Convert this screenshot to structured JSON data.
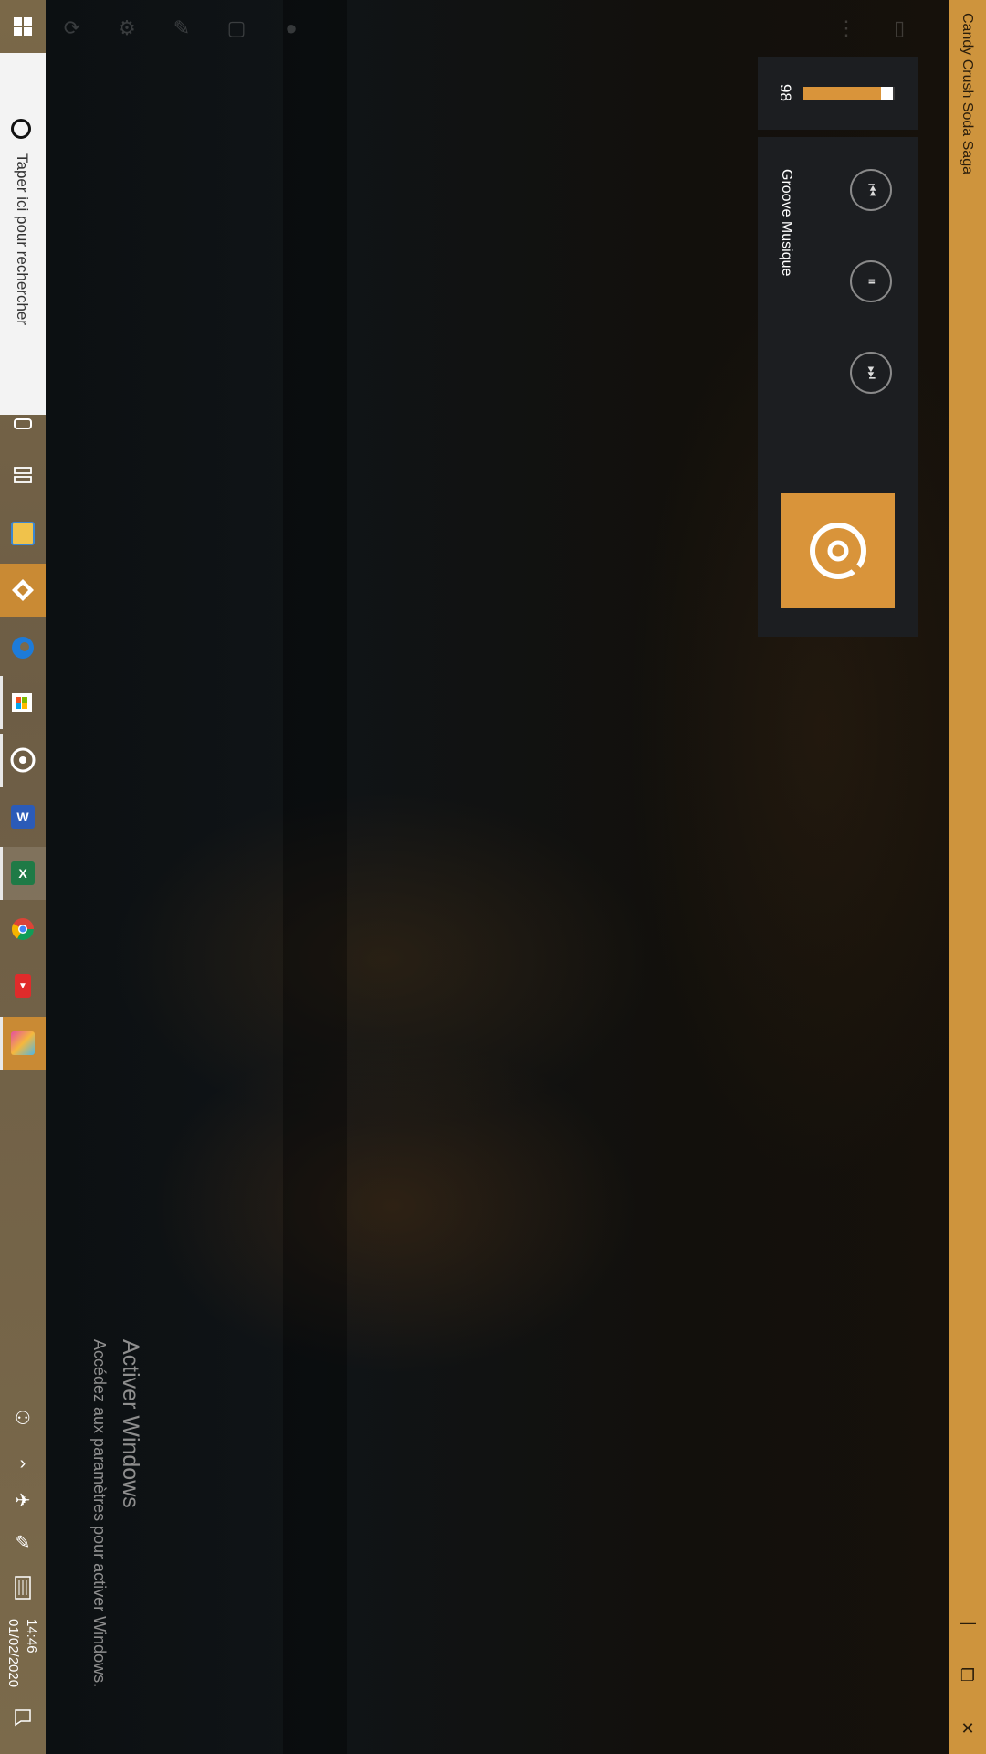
{
  "taskbar": {
    "search_placeholder": "Taper ici pour rechercher",
    "apps": [
      {
        "name": "file-explorer"
      },
      {
        "name": "brave-browser"
      },
      {
        "name": "edge"
      },
      {
        "name": "microsoft-store"
      },
      {
        "name": "groove-music"
      },
      {
        "name": "word"
      },
      {
        "name": "excel"
      },
      {
        "name": "chrome"
      },
      {
        "name": "youtube"
      },
      {
        "name": "candy-crush"
      }
    ],
    "clock": {
      "time": "14:46",
      "date": "01/02/2020"
    }
  },
  "window": {
    "title": "Candy Crush Soda Saga",
    "minimize_glyph": "—",
    "restore_glyph": "❐",
    "close_glyph": "✕"
  },
  "media_overlay": {
    "volume": 98,
    "app_name": "Groove Musique",
    "buttons": {
      "previous": "⏮",
      "pause": "⏸",
      "next": "⏭"
    }
  },
  "watermark": {
    "title": "Activer Windows",
    "subtitle": "Accédez aux paramètres pour activer Windows."
  },
  "colors": {
    "accent": "#d9943a",
    "titlebar": "#ce943d",
    "panel": "#1c1e21"
  }
}
